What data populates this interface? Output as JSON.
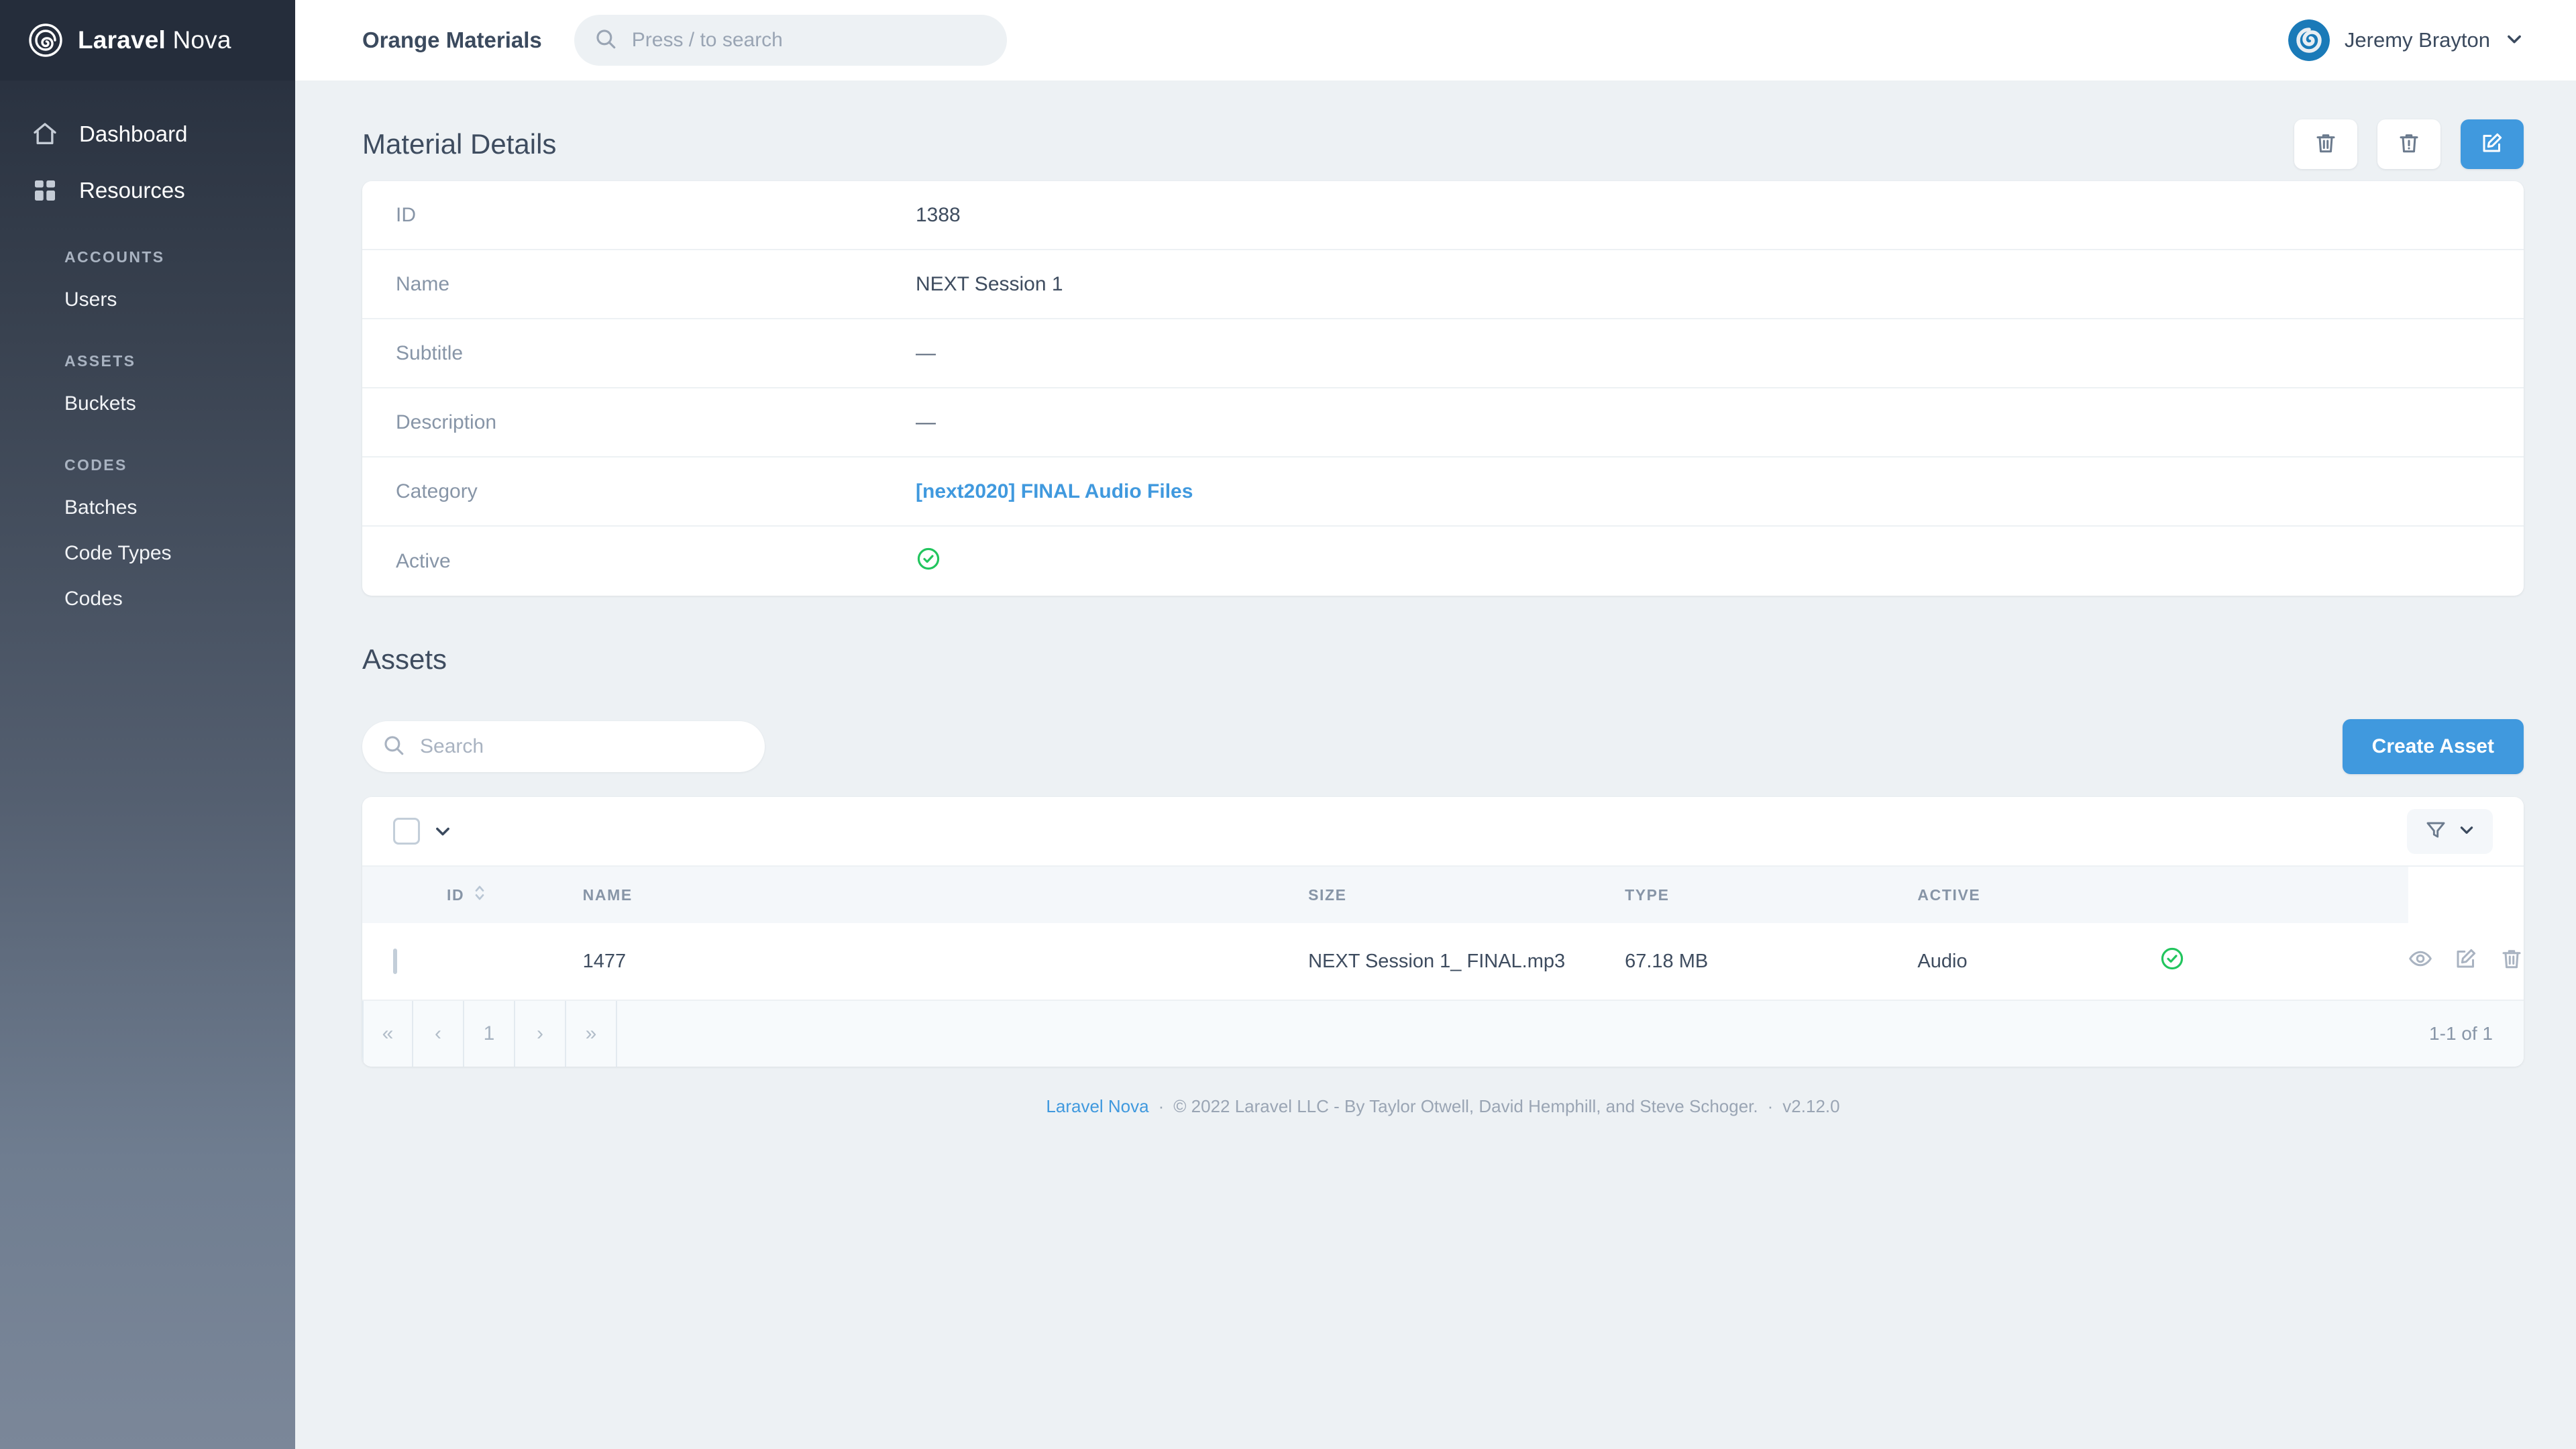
{
  "brand": {
    "name_bold": "Laravel",
    "name_light": "Nova",
    "logo_icon": "nova-spiral-logo-icon"
  },
  "sidebar": {
    "main_items": [
      {
        "label": "Dashboard",
        "icon": "home-icon"
      },
      {
        "label": "Resources",
        "icon": "grid-icon"
      }
    ],
    "groups": [
      {
        "label": "ACCOUNTS",
        "items": [
          {
            "label": "Users"
          }
        ]
      },
      {
        "label": "ASSETS",
        "items": [
          {
            "label": "Buckets"
          }
        ]
      },
      {
        "label": "CODES",
        "items": [
          {
            "label": "Batches"
          },
          {
            "label": "Code Types"
          },
          {
            "label": "Codes"
          }
        ]
      }
    ]
  },
  "header": {
    "page_title": "Orange Materials",
    "search_placeholder": "Press / to search",
    "search_value": "",
    "search_icon": "search-icon",
    "user_name": "Jeremy Brayton",
    "avatar_icon": "user-avatar-icon",
    "chevron_icon": "chevron-down-icon"
  },
  "detail_panel": {
    "title": "Material Details",
    "actions": [
      {
        "name": "delete",
        "icon": "trash-icon"
      },
      {
        "name": "force-delete",
        "icon": "trash-alert-icon"
      },
      {
        "name": "edit",
        "icon": "edit-pencil-icon"
      }
    ],
    "rows": [
      {
        "label": "ID",
        "value": "1388",
        "type": "text"
      },
      {
        "label": "Name",
        "value": "NEXT Session 1",
        "type": "text"
      },
      {
        "label": "Subtitle",
        "value": "—",
        "type": "dash"
      },
      {
        "label": "Description",
        "value": "—",
        "type": "dash"
      },
      {
        "label": "Category",
        "value": "[next2020] FINAL Audio Files",
        "type": "link"
      },
      {
        "label": "Active",
        "value": "",
        "type": "check"
      }
    ]
  },
  "assets": {
    "title": "Assets",
    "search_placeholder": "Search",
    "search_value": "",
    "search_icon": "search-icon",
    "create_label": "Create Asset",
    "select_all_icon": "checkbox-icon",
    "select_all_chevron": "chevron-down-icon",
    "filter_icon": "filter-funnel-icon",
    "filter_chevron": "chevron-down-icon",
    "columns": [
      {
        "label": "ID",
        "sortable": true,
        "sort_icon": "sort-arrows-icon"
      },
      {
        "label": "NAME",
        "sortable": false
      },
      {
        "label": "SIZE",
        "sortable": false
      },
      {
        "label": "TYPE",
        "sortable": false
      },
      {
        "label": "ACTIVE",
        "sortable": false
      }
    ],
    "rows": [
      {
        "id": "1477",
        "name": "NEXT Session 1_ FINAL.mp3",
        "size": "67.18 MB",
        "type": "Audio",
        "active": true,
        "actions": [
          {
            "name": "view",
            "icon": "eye-icon"
          },
          {
            "name": "edit",
            "icon": "edit-pencil-icon"
          },
          {
            "name": "delete",
            "icon": "trash-icon"
          }
        ]
      }
    ],
    "pagination": {
      "first": "«",
      "prev": "‹",
      "pages": [
        "1"
      ],
      "next": "›",
      "last": "»",
      "count_text": "1-1 of 1"
    }
  },
  "footer": {
    "link_label": "Laravel Nova",
    "sep1": "·",
    "copyright": "© 2022 Laravel LLC - By Taylor Otwell, David Hemphill, and Steve Schoger.",
    "sep2": "·",
    "version": "v2.12.0"
  },
  "colors": {
    "accent_blue": "#4099de",
    "link_blue": "#4099de",
    "active_green": "#22c55e",
    "sidebar_dark": "#252d3b",
    "page_bg": "#edf1f4"
  }
}
